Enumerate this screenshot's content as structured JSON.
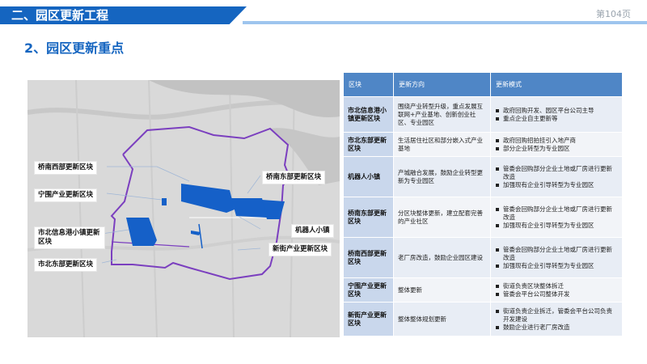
{
  "header": {
    "title": "二、园区更新工程",
    "page_number": "第104页"
  },
  "subtitle": "2、园区更新重点",
  "map": {
    "labels": {
      "qiaonan_west": "桥南西部更新区块",
      "qiaonan_east": "桥南东部更新区块",
      "ningwei": "宁围产业更新区块",
      "robot": "机器人小镇",
      "xinjie": "新街产业更新区块",
      "xingang": "市北信息港小镇更新区块",
      "shibei_east": "市北东部更新区块"
    },
    "colors": {
      "boundary": "#7b3fbf",
      "highlight": "#1560c8",
      "base": "#dcdcdc"
    }
  },
  "table": {
    "headers": [
      "区块",
      "更新方向",
      "更新模式"
    ],
    "rows": [
      {
        "block": "市北信息港小镇更新区块",
        "direction": "围绕产业转型升级，重点发展互联网+产业基地、创新创业社区、专业园区",
        "modes": [
          "政府回购开发、园区平台公司主导",
          "重点企业自主更新等"
        ]
      },
      {
        "block": "市北东部更新区块",
        "direction": "生活居住社区和部分嵌入式产业基地",
        "modes": [
          "政府回购招拍挂引入地产商",
          "部分企业转型为专业园区"
        ]
      },
      {
        "block": "机器人小镇",
        "direction": "产城融合发展，鼓励企业转型更新为专业园区",
        "modes": [
          "管委会回购部分企业土地或厂房进行更新改造",
          "加强现有企业引导转型为专业园区"
        ]
      },
      {
        "block": "桥南东部更新区块",
        "direction": "分区块整体更新，建立配套完善的产业社区",
        "modes": [
          "管委会回购部分企业土地或厂房进行更新改造",
          "加强现有企业引导转型为专业园区"
        ]
      },
      {
        "block": "桥南西部更新区块",
        "direction": "老厂房改造，鼓励企业园区建设",
        "modes": [
          "管委会回购部分企业土地或厂房进行更新改造",
          "加强现有企业引导转型为专业园区"
        ]
      },
      {
        "block": "宁围产业更新区块",
        "direction": "整体更新",
        "modes": [
          "街道负责区块整体拆迁",
          "管委会平台公司整体开发"
        ]
      },
      {
        "block": "新街产业更新区块",
        "direction": "整体整体规划更新",
        "modes": [
          "街道负责企业拆迁，管委会平台公司负责开发建设",
          "鼓励企业进行老厂房改造"
        ]
      }
    ]
  }
}
